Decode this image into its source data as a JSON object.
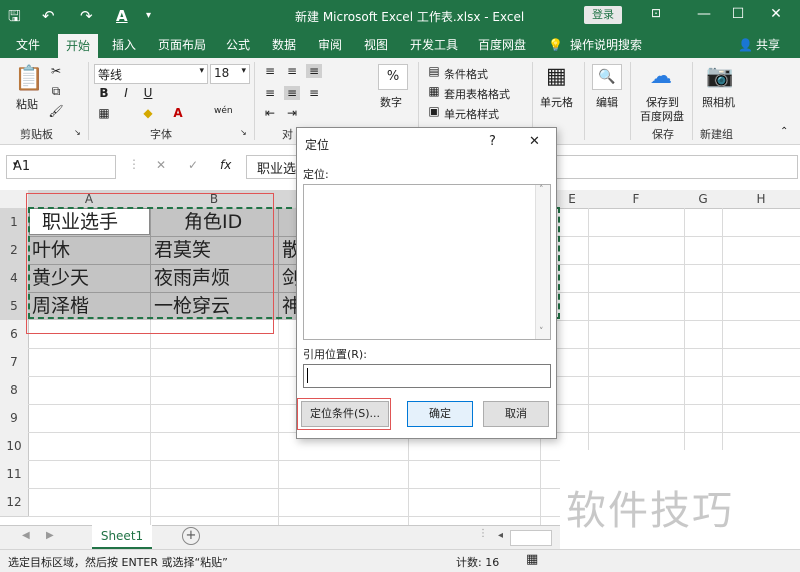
{
  "window": {
    "title": "新建 Microsoft Excel 工作表.xlsx - Excel",
    "login_label": "登录",
    "minimize": "—",
    "restore": "☐",
    "close": "✕"
  },
  "ribbon_tabs": [
    "文件",
    "开始",
    "插入",
    "页面布局",
    "公式",
    "数据",
    "审阅",
    "视图",
    "开发工具",
    "百度网盘",
    "操作说明搜索",
    "共享"
  ],
  "ribbon": {
    "paste_label": "粘贴",
    "clipboard_group": "剪贴板",
    "font_name": "等线",
    "font_size": "18",
    "font_group": "字体",
    "bold": "B",
    "italic": "I",
    "underline": "U",
    "wen": "wén",
    "align_group_partial": "对",
    "number_label": "数字",
    "number_icon": "%",
    "cond_format": "条件格式",
    "table_format": "套用表格格式",
    "cell_style": "单元格样式",
    "cells_label": "单元格",
    "edit_label": "编辑",
    "save_baidu_1": "保存到",
    "save_baidu_2": "百度网盘",
    "save_group": "保存",
    "camera_label": "照相机",
    "new_group": "新建组"
  },
  "formula_bar": {
    "name_box": "A1",
    "cancel": "✕",
    "enter": "✓",
    "fx": "fx",
    "content": "职业选"
  },
  "grid": {
    "columns": [
      "A",
      "B",
      "E",
      "F",
      "G",
      "H"
    ],
    "rows": [
      "1",
      "2",
      "4",
      "5",
      "6",
      "7",
      "8",
      "9",
      "10",
      "11",
      "12"
    ],
    "cells": {
      "a1": "职业选手",
      "b1": "角色ID",
      "a2": "叶休",
      "b2": "君莫笑",
      "c2": "散",
      "a4": "黄少天",
      "b4": "夜雨声烦",
      "c4": "剑",
      "a5": "周泽楷",
      "b5": "一枪穿云",
      "c5": "神"
    }
  },
  "dialog": {
    "title": "定位",
    "help": "?",
    "close": "✕",
    "goto_label": "定位:",
    "ref_label": "引用位置(R):",
    "special_button": "定位条件(S)...",
    "ok_button": "确定",
    "cancel_button": "取消"
  },
  "sheet_tabs": {
    "active": "Sheet1",
    "add": "+"
  },
  "status": {
    "message": "选定目标区域，然后按 ENTER 或选择“粘贴”",
    "count": "计数: 16"
  },
  "watermark": "软件技巧",
  "colors": {
    "excel_green": "#217346",
    "selection_gray": "#c4c4c4",
    "highlight_red": "#e05555"
  }
}
